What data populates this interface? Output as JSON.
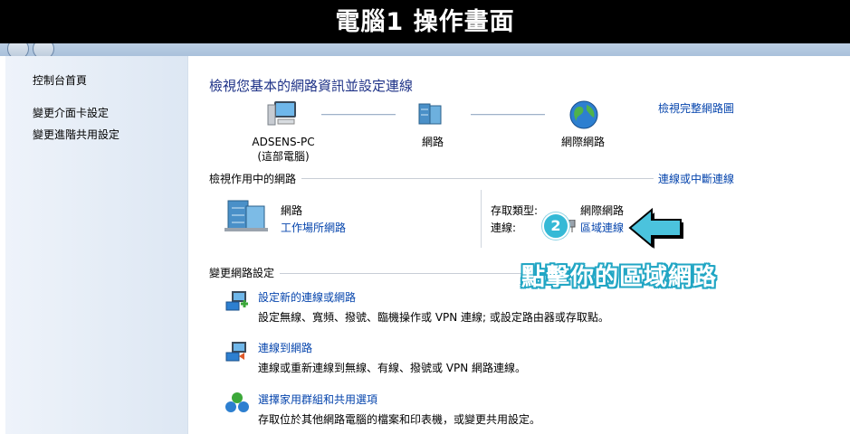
{
  "banner": {
    "title": "電腦1  操作畫面"
  },
  "sidebar": {
    "items": [
      {
        "label": "控制台首頁"
      },
      {
        "label": "變更介面卡設定"
      },
      {
        "label": "變更進階共用設定"
      }
    ]
  },
  "main": {
    "title": "檢視您基本的網路資訊並設定連線",
    "full_map_link": "檢視完整網路圖",
    "map": {
      "computer_name": "ADSENS-PC",
      "computer_sub": "(這部電腦)",
      "network": "網路",
      "internet": "網際網路"
    },
    "active": {
      "header": "檢視作用中的網路",
      "connect_link": "連線或中斷連線",
      "network_name": "網路",
      "network_type": "工作場所網路",
      "access_type_label": "存取類型:",
      "access_type_value": "網際網路",
      "connection_label": "連線:",
      "connection_value": "區域連線"
    },
    "change": {
      "header": "變更網路設定",
      "tasks": [
        {
          "title": "設定新的連線或網路",
          "desc": "設定無線、寬頻、撥號、臨機操作或 VPN 連線; 或設定路由器或存取點。"
        },
        {
          "title": "連線到網路",
          "desc": "連線或重新連線到無線、有線、撥號或 VPN 網路連線。"
        },
        {
          "title": "選擇家用群組和共用選項",
          "desc": "存取位於其他網路電腦的檔案和印表機，或變更共用設定。"
        }
      ]
    }
  },
  "annotation": {
    "step_number": "2",
    "callout_text": "點擊你的區域網路",
    "accent_color": "#35b9d6"
  }
}
